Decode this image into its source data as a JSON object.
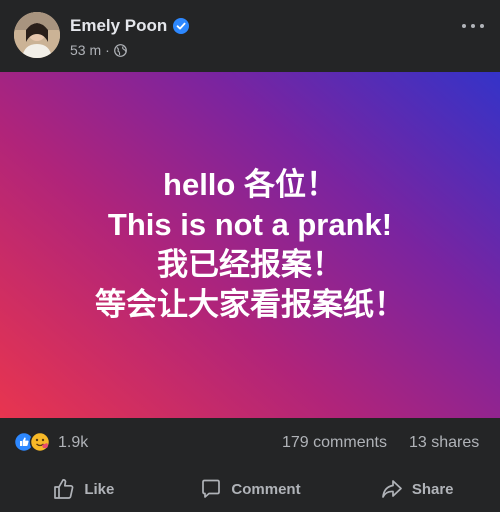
{
  "post": {
    "author": "Emely Poon",
    "time": "53 m",
    "separator": "·",
    "lines": [
      "hello 各位！",
      "This is not a prank!",
      "我已经报案！",
      "等会让大家看报案纸！"
    ]
  },
  "stats": {
    "reactions": "1.9k",
    "comments": "179 comments",
    "shares": "13 shares"
  },
  "actions": {
    "like": "Like",
    "comment": "Comment",
    "share": "Share"
  },
  "colors": {
    "background": "#242526",
    "verified": "#2d88ff",
    "gradient_start": "#e8354f",
    "gradient_end": "#3433c8"
  }
}
